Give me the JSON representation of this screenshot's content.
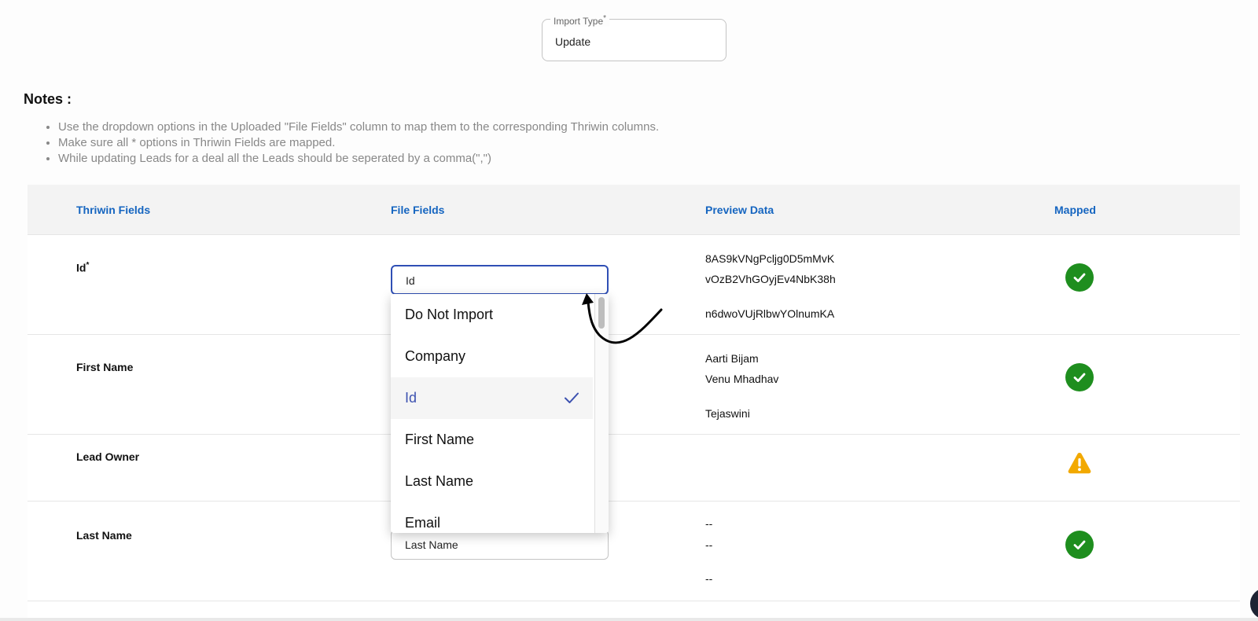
{
  "import_type": {
    "label": "Import Type",
    "required_mark": "*",
    "value": "Update"
  },
  "notes": {
    "title": "Notes :",
    "items": [
      "Use the dropdown options in the Uploaded \"File Fields\" column to map them to the corresponding Thriwin columns.",
      "Make sure all * options in Thriwin Fields are mapped.",
      "While updating Leads for a deal all the Leads should be seperated by a comma(\",\")"
    ]
  },
  "table": {
    "headers": [
      "Thriwin Fields",
      "File Fields",
      "Preview Data",
      "Mapped"
    ],
    "rows": [
      {
        "field": "Id",
        "required_mark": "*",
        "file_field": "Id",
        "preview": [
          "8AS9kVNgPcljg0D5mMvK",
          "vOzB2VhGOyjEv4NbK38h",
          "n6dwoVUjRlbwYOlnumKA"
        ],
        "status": "mapped"
      },
      {
        "field": "First Name",
        "file_field": "",
        "preview": [
          "Aarti Bijam",
          "Venu Mhadhav",
          "Tejaswini"
        ],
        "status": "mapped"
      },
      {
        "field": "Lead Owner",
        "file_field": "",
        "preview": [],
        "status": "warning"
      },
      {
        "field": "Last Name",
        "file_field": "Last Name",
        "preview": [
          "--",
          "--",
          "--"
        ],
        "status": "mapped"
      }
    ]
  },
  "dropdown": {
    "options": [
      "Do Not Import",
      "Company",
      "Id",
      "First Name",
      "Last Name",
      "Email"
    ],
    "selected": "Id"
  },
  "colors": {
    "header_text": "#1565c0",
    "active_border": "#2f4fb5",
    "success": "#1e8e1e",
    "warning": "#f2a900"
  },
  "icons": [
    "check-circle-icon",
    "warning-triangle-icon",
    "checkmark-icon",
    "curved-arrow-icon"
  ]
}
